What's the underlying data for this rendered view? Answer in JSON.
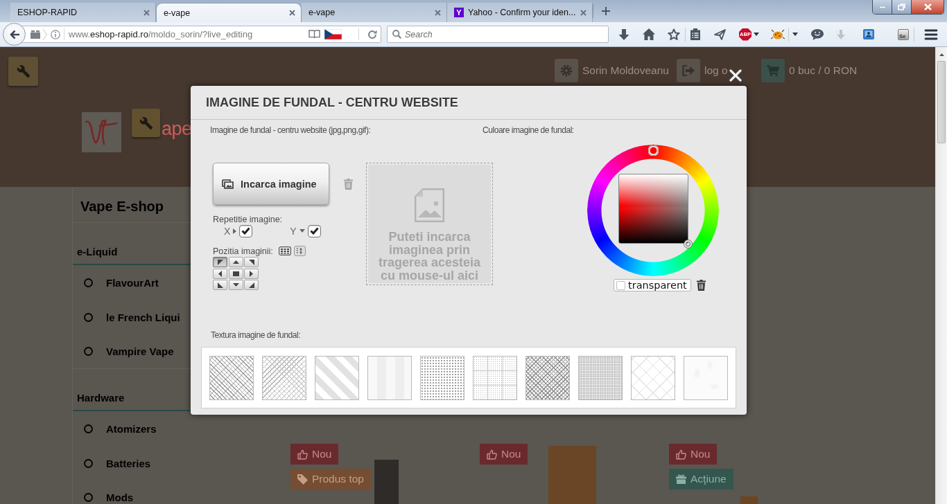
{
  "browser": {
    "tabs": [
      {
        "title": "ESHOP-RAPID",
        "selected": false
      },
      {
        "title": "e-vape",
        "selected": true
      },
      {
        "title": "e-vape",
        "selected": false
      },
      {
        "title": "Yahoo - Confirm your iden...",
        "favicon": "Y",
        "selected": false
      }
    ],
    "address": {
      "host_prefix": "www.",
      "domain": "eshop-rapid.ro",
      "path": "/moldo_sorin/?live_editing"
    },
    "search": {
      "placeholder": "Search"
    },
    "toolbar": {
      "adblock_badge": "ABP",
      "extension_badge": "Se"
    }
  },
  "page": {
    "header": {
      "user_name": "Sorin Moldoveanu",
      "logout": "log o",
      "cart": "0 buc / 0 RON",
      "logo_text": "ape"
    },
    "sidebar": {
      "title": "Vape E-shop",
      "groups": [
        {
          "title": "e-Liquid",
          "items": [
            {
              "label": "FlavourArt"
            },
            {
              "label": "le French Liqui"
            },
            {
              "label": "Vampire Vape"
            }
          ]
        },
        {
          "title": "Hardware",
          "items": [
            {
              "label": "Atomizers"
            },
            {
              "label": "Batteries"
            },
            {
              "label": "Mods"
            }
          ]
        }
      ]
    },
    "products": [
      {
        "badges": [
          {
            "kind": "new",
            "label": "Nou"
          },
          {
            "kind": "top",
            "label": "Produs top"
          }
        ]
      },
      {
        "badges": [
          {
            "kind": "new",
            "label": "Nou"
          }
        ]
      },
      {
        "badges": [
          {
            "kind": "new",
            "label": "Nou"
          },
          {
            "kind": "sale",
            "label": "Acţiune"
          }
        ]
      }
    ]
  },
  "dialog": {
    "title": "IMAGINE DE FUNDAL - CENTRU WEBSITE",
    "image_label": "Imagine de fundal - centru website (jpg,png,gif):",
    "upload_button": "Incarca imagine",
    "repeat_label": "Repetitie imagine:",
    "repeat": [
      {
        "label": "X",
        "checked": true
      },
      {
        "label": "Y",
        "checked": true
      }
    ],
    "position_label": "Pozitia imaginii:",
    "positions": [
      {
        "selected": true
      },
      {
        "selected": false
      },
      {
        "selected": false
      },
      {
        "selected": false
      },
      {
        "selected": false
      },
      {
        "selected": false
      },
      {
        "selected": false
      },
      {
        "selected": false
      },
      {
        "selected": false
      }
    ],
    "dropzone": "Puteti incarca imaginea prin tragerea acesteia cu mouse-ul aici",
    "color_label": "Culoare imagine de fundal:",
    "transparent": {
      "label": "transparent",
      "checked": false
    },
    "texture_label": "Textura imagine de fundal:",
    "textures": [
      {
        "kind": "crosshatch"
      },
      {
        "kind": "diagonal-mesh"
      },
      {
        "kind": "wide-stripes"
      },
      {
        "kind": "vertical-stripes"
      },
      {
        "kind": "dots"
      },
      {
        "kind": "dotted-grid"
      },
      {
        "kind": "dense-mesh"
      },
      {
        "kind": "fine-dots"
      },
      {
        "kind": "lattice"
      },
      {
        "kind": "faint-pattern"
      }
    ]
  }
}
